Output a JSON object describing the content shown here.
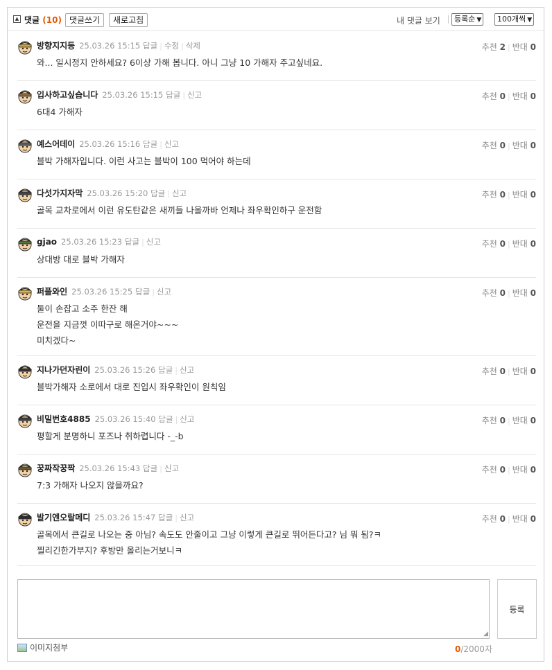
{
  "toolbar": {
    "collapse_icon": "collapse-up-icon",
    "title": "댓글",
    "count": "(10)",
    "write_label": "댓글쓰기",
    "refresh_label": "새로고침",
    "my_comments_label": "내 댓글 보기",
    "sort_value": "등록순",
    "per_page_value": "100개씩"
  },
  "comments": [
    {
      "nick": "방향지지등",
      "date": "25.03.26 15:15",
      "actions": [
        "답글",
        "수정",
        "삭제"
      ],
      "lines": [
        "와... 일시정지 안하세요? 6이상 가해 봅니다. 아니 그냥 10 가해자 주고싶네요."
      ],
      "up": "2",
      "down": "0",
      "up_label": "추천",
      "down_label": "반대"
    },
    {
      "nick": "입사하고싶습니다",
      "date": "25.03.26 15:15",
      "actions": [
        "답글",
        "신고"
      ],
      "lines": [
        "6대4 가해자"
      ],
      "up": "0",
      "down": "0",
      "up_label": "추천",
      "down_label": "반대"
    },
    {
      "nick": "예스어데이",
      "date": "25.03.26 15:16",
      "actions": [
        "답글",
        "신고"
      ],
      "lines": [
        "블박 가해자입니다. 이런 사고는 블박이 100 먹어야 하는데"
      ],
      "up": "0",
      "down": "0",
      "up_label": "추천",
      "down_label": "반대"
    },
    {
      "nick": "다섯가지자막",
      "date": "25.03.26 15:20",
      "actions": [
        "답글",
        "신고"
      ],
      "lines": [
        "골목 교차로에서 이런 유도탄같은 새끼들 나올까바 언제나 좌우확인하구 운전함"
      ],
      "up": "0",
      "down": "0",
      "up_label": "추천",
      "down_label": "반대"
    },
    {
      "nick": "gjao",
      "date": "25.03.26 15:23",
      "actions": [
        "답글",
        "신고"
      ],
      "lines": [
        "상대방 대로 블박 가해자"
      ],
      "up": "0",
      "down": "0",
      "up_label": "추천",
      "down_label": "반대"
    },
    {
      "nick": "퍼플와인",
      "date": "25.03.26 15:25",
      "actions": [
        "답글",
        "신고"
      ],
      "lines": [
        "둘이 손잡고 소주 한잔 해",
        "운전을 지금껏 이따구로 해온거야~~~",
        "미치겠다~"
      ],
      "up": "0",
      "down": "0",
      "up_label": "추천",
      "down_label": "반대"
    },
    {
      "nick": "지나가던자린이",
      "date": "25.03.26 15:26",
      "actions": [
        "답글",
        "신고"
      ],
      "lines": [
        "블박가해자 소로에서 대로 진입시 좌우확인이 원칙임"
      ],
      "up": "0",
      "down": "0",
      "up_label": "추천",
      "down_label": "반대"
    },
    {
      "nick": "비밀번호4885",
      "date": "25.03.26 15:40",
      "actions": [
        "답글",
        "신고"
      ],
      "lines": [
        "평할게 분명하니 포즈나 취하렵니다 -_-b"
      ],
      "up": "0",
      "down": "0",
      "up_label": "추천",
      "down_label": "반대"
    },
    {
      "nick": "꿍짜작꿍짝",
      "date": "25.03.26 15:43",
      "actions": [
        "답글",
        "신고"
      ],
      "lines": [
        "7:3 가해자 나오지 않을까요?"
      ],
      "up": "0",
      "down": "0",
      "up_label": "추천",
      "down_label": "반대"
    },
    {
      "nick": "발기엔오랄메디",
      "date": "25.03.26 15:47",
      "actions": [
        "답글",
        "신고"
      ],
      "lines": [
        "골목에서 큰길로 나오는 중 아님? 속도도 안줄이고 그냥 이렇게 큰길로 뛰어든다고? 님 뭐 됨?ㅋ",
        "찔리긴한가부지? 후방만 올리는거보니ㅋ"
      ],
      "up": "0",
      "down": "0",
      "up_label": "추천",
      "down_label": "반대"
    }
  ],
  "form": {
    "submit_label": "등록",
    "attach_label": "이미지첨부",
    "char_count": "0",
    "char_max": "/2000자"
  },
  "colors": {
    "accent": "#e55a00",
    "border": "#cfcfcf"
  }
}
